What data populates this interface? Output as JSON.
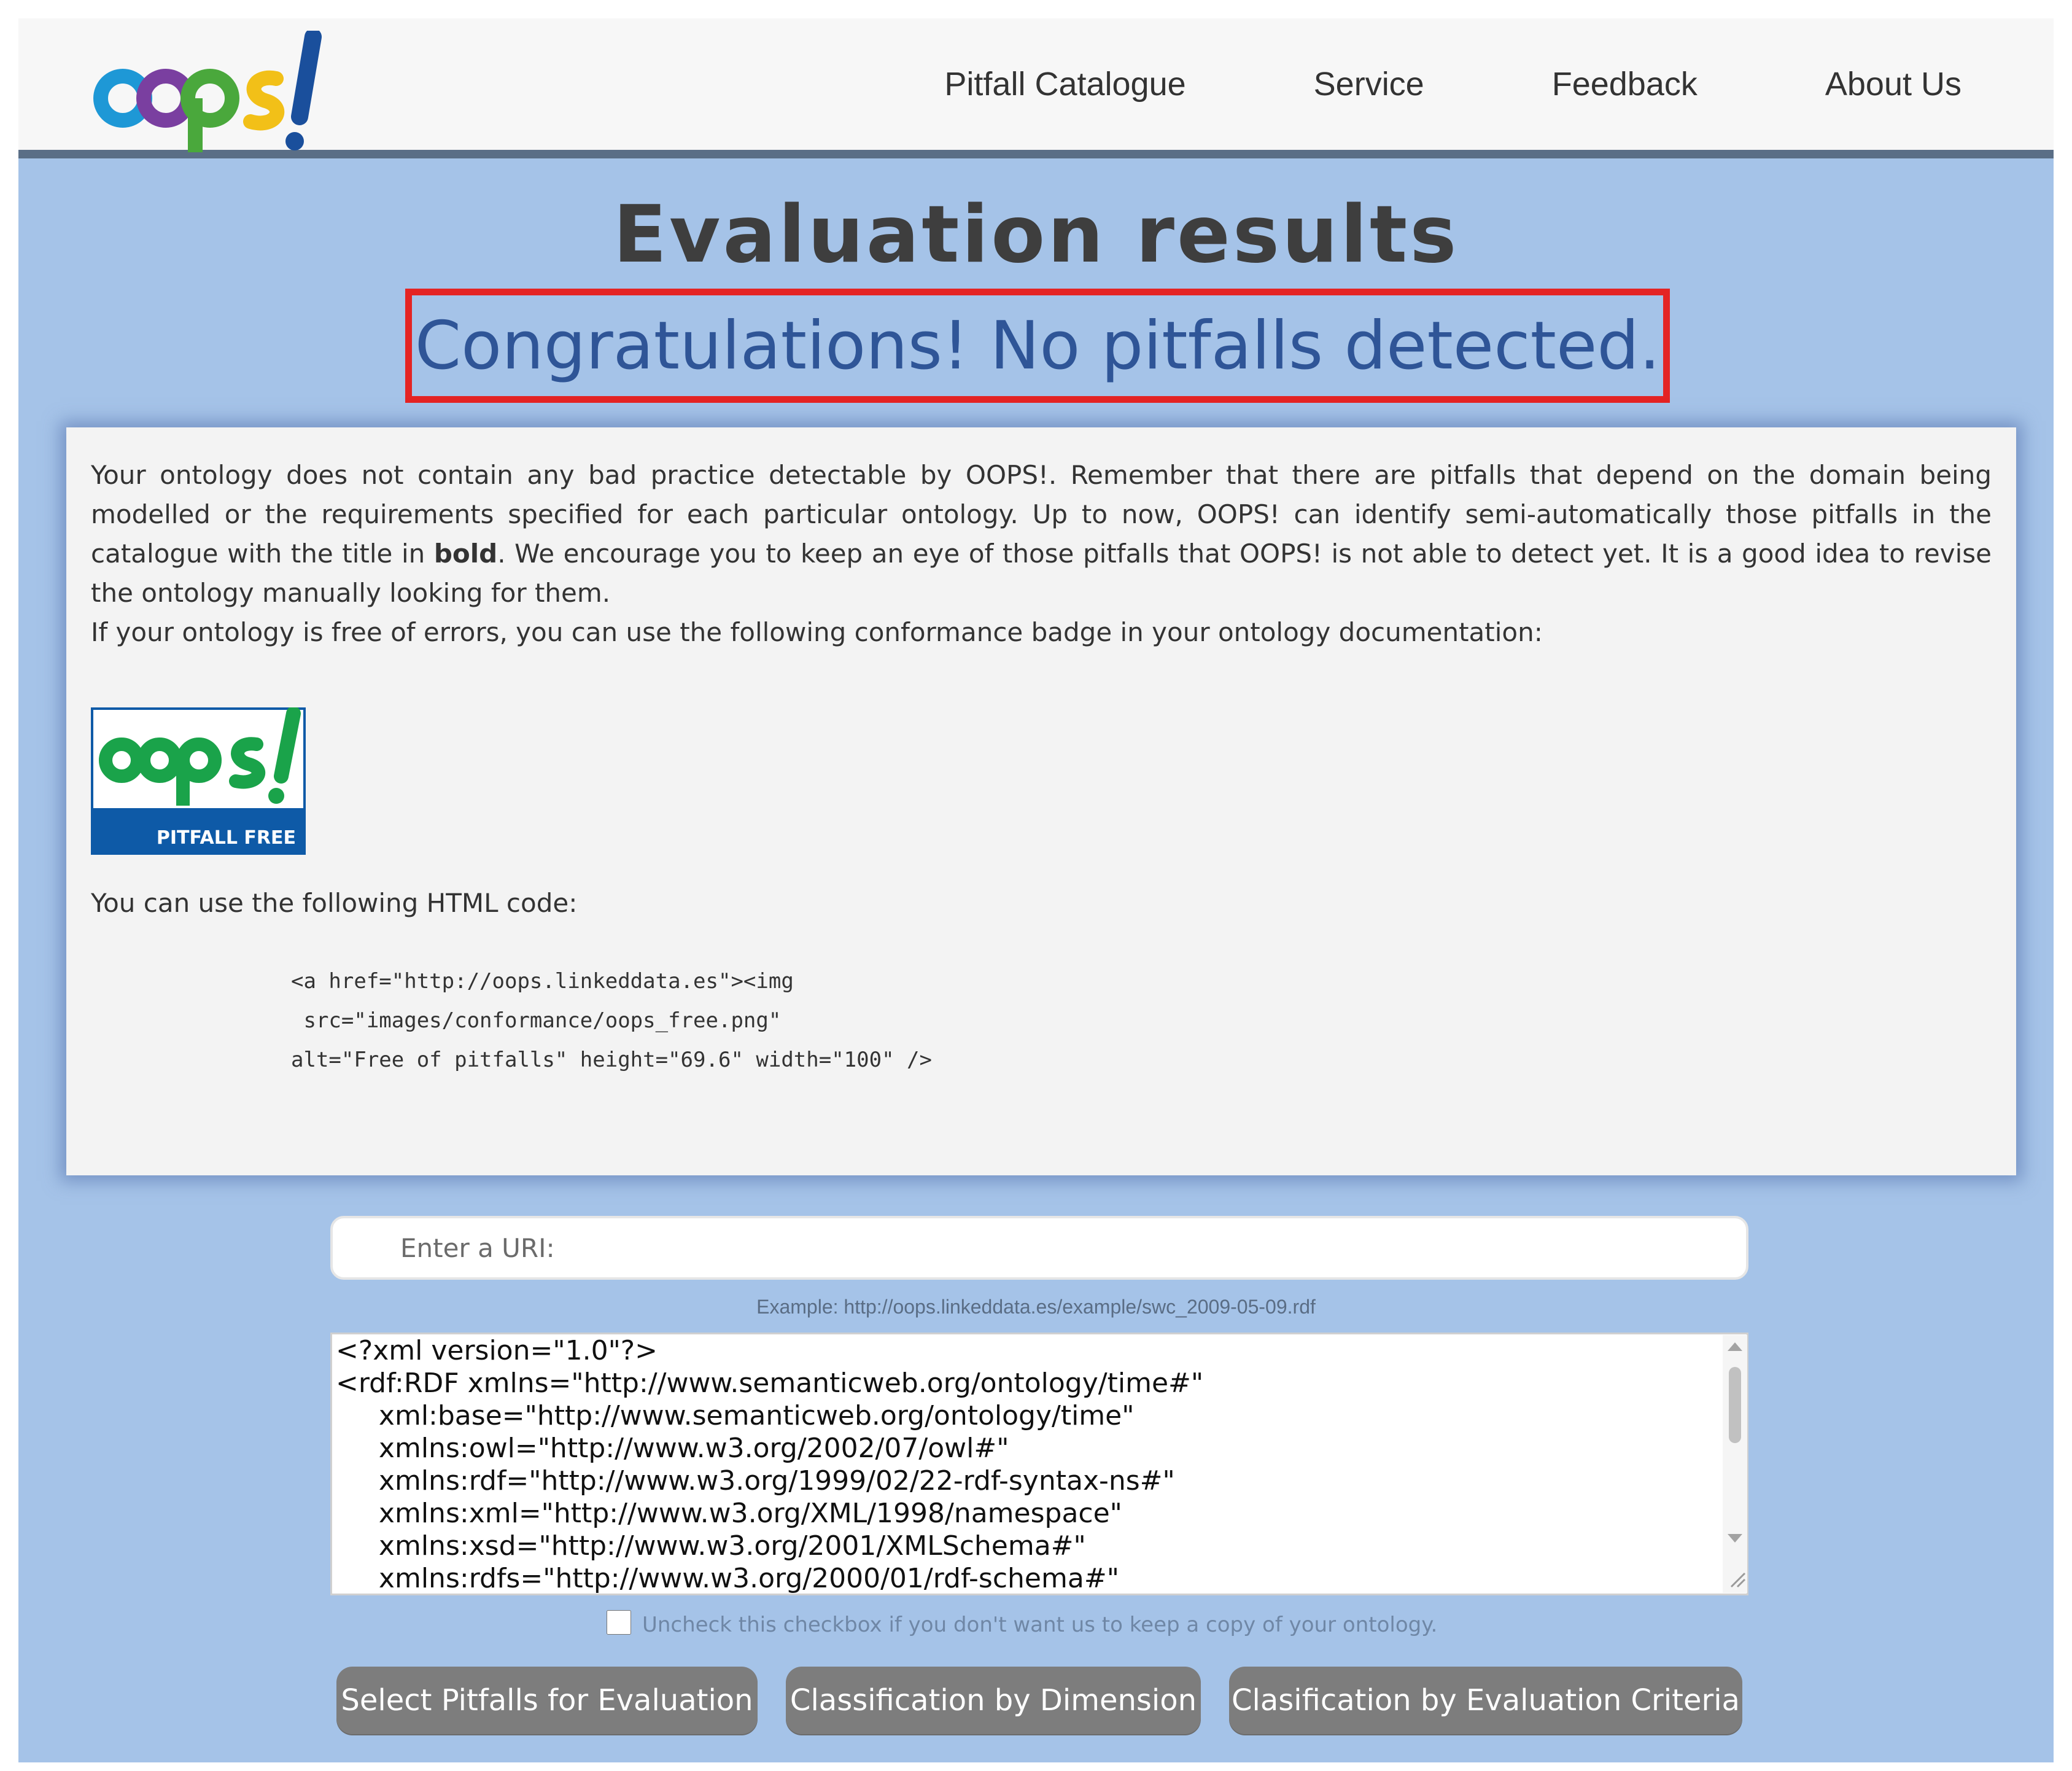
{
  "nav": {
    "logo_label": "oops!",
    "links": [
      "Pitfall Catalogue",
      "Service",
      "Feedback",
      "About Us"
    ]
  },
  "main": {
    "title": "Evaluation results",
    "result": "Congratulations! No pitfalls detected."
  },
  "info": {
    "paragraph_before_bold": "Your ontology does not contain any bad practice detectable by OOPS!. Remember that there are pitfalls that depend on the domain being modelled or the requirements specified for each particular ontology. Up to now, OOPS! can identify semi-automatically those pitfalls in the catalogue with the title in ",
    "bold_word": "bold",
    "paragraph_after_bold": ". We encourage you to keep an eye of those pitfalls that OOPS! is not able to detect yet. It is a good idea to revise the ontology manually looking for them.",
    "badge_line": "If your ontology is free of errors, you can use the following conformance badge in your ontology documentation:",
    "badge_logo": "oops!",
    "badge_caption": "PITFALL FREE",
    "html_code_label": "You can use the following HTML code:",
    "code": "<a href=\"http://oops.linkeddata.es\"><img\n src=\"images/conformance/oops_free.png\"\nalt=\"Free of pitfalls\" height=\"69.6\" width=\"100\" />"
  },
  "form": {
    "uri_placeholder": "Enter a URI:",
    "example": "Example: http://oops.linkeddata.es/example/swc_2009-05-09.rdf",
    "rdf_content": "<?xml version=\"1.0\"?>\n<rdf:RDF xmlns=\"http://www.semanticweb.org/ontology/time#\"\n     xml:base=\"http://www.semanticweb.org/ontology/time\"\n     xmlns:owl=\"http://www.w3.org/2002/07/owl#\"\n     xmlns:rdf=\"http://www.w3.org/1999/02/22-rdf-syntax-ns#\"\n     xmlns:xml=\"http://www.w3.org/XML/1998/namespace\"\n     xmlns:xsd=\"http://www.w3.org/2001/XMLSchema#\"\n     xmlns:rdfs=\"http://www.w3.org/2000/01/rdf-schema#\"",
    "checkbox_label": "Uncheck this checkbox if you don't want us to keep a copy of your ontology.",
    "checkbox_checked": false,
    "buttons": {
      "select": "Select Pitfalls for Evaluation",
      "dimension": "Classification by Dimension",
      "criteria": "Clasification by Evaluation Criteria"
    }
  },
  "colors": {
    "background": "#a5c3e8",
    "result_text": "#2f5597",
    "result_border": "#e42424",
    "button": "#7d7d7d",
    "badge_green": "#1aa34a",
    "badge_blue": "#0e5aa7"
  }
}
